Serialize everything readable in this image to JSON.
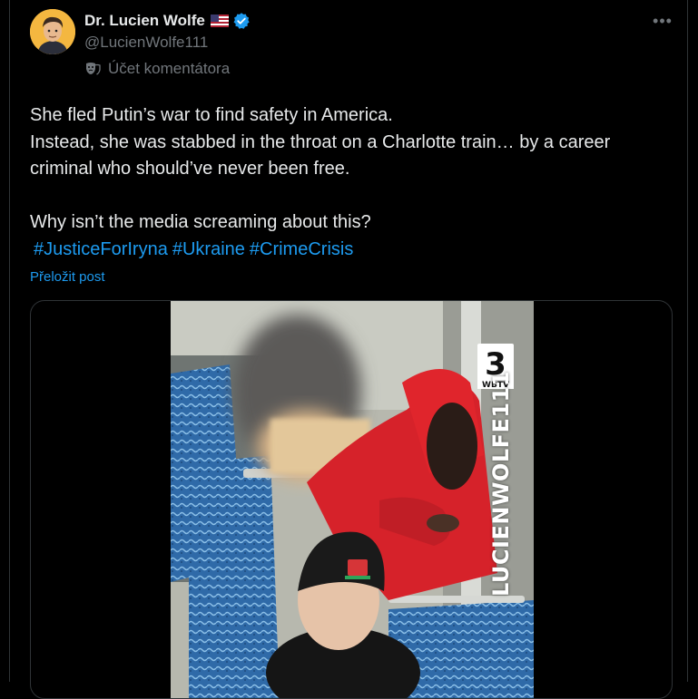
{
  "author": {
    "display_name": "Dr. Lucien Wolfe",
    "handle": "@LucienWolfe111",
    "account_label": "Účet komentátora",
    "flag_icon": "us-flag-icon",
    "verified_icon": "verified-badge-icon",
    "verified_color": "#1d9bf0"
  },
  "menu": {
    "more_label": "•••"
  },
  "post": {
    "lines": [
      "She fled Putin’s war to find safety in America.",
      "Instead, she was stabbed in the throat on a Charlotte train… by a career",
      "criminal who should’ve never been free.",
      "Why isn’t the media screaming about this?"
    ],
    "hashtags": [
      "#JusticeForIryna",
      "#Ukraine",
      "#CrimeCrisis"
    ],
    "translate_label": "Přeložit post"
  },
  "media": {
    "type": "video",
    "watermark_text": "LUCIENWOLFE111",
    "station_logo_text": "WBTV",
    "station_logo_number": "3"
  },
  "colors": {
    "background": "#000000",
    "text": "#e7e9ea",
    "secondary_text": "#71767b",
    "link": "#1d9bf0",
    "border": "#2f3336"
  }
}
